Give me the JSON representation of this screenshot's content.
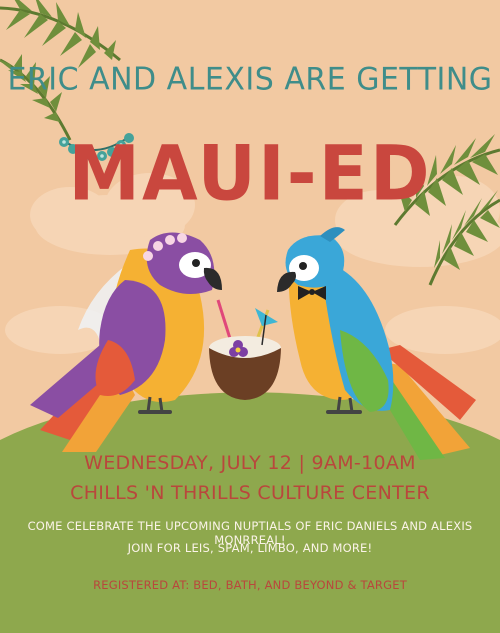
{
  "invitation": {
    "headline": "Eric and Alexis are getting",
    "title": "Maui-Ed",
    "datetime": "Wednesday, July 12 | 9AM-10AM",
    "venue": "Chills 'n Thrills Culture Center",
    "details_line1": "Come celebrate the upcoming nuptials of Eric Daniels and Alexis Monrreal!",
    "details_line2": "Join for leis, spam, limbo, and more!",
    "registry": "Registered at: Bed, Bath, and Beyond & Target"
  },
  "colors": {
    "background": "#f2c9a2",
    "headline_teal": "#3f8d8a",
    "title_red": "#c9473e",
    "event_red": "#b9473c",
    "details_white": "#fbf3e8",
    "hill_green": "#8ea84d",
    "lei_teal": "#45a29a"
  },
  "icons": [
    "palm-leaf-icon",
    "bride-parrot-icon",
    "groom-parrot-icon",
    "coconut-drink-icon",
    "cocktail-umbrella-icon",
    "flower-lei-icon"
  ]
}
